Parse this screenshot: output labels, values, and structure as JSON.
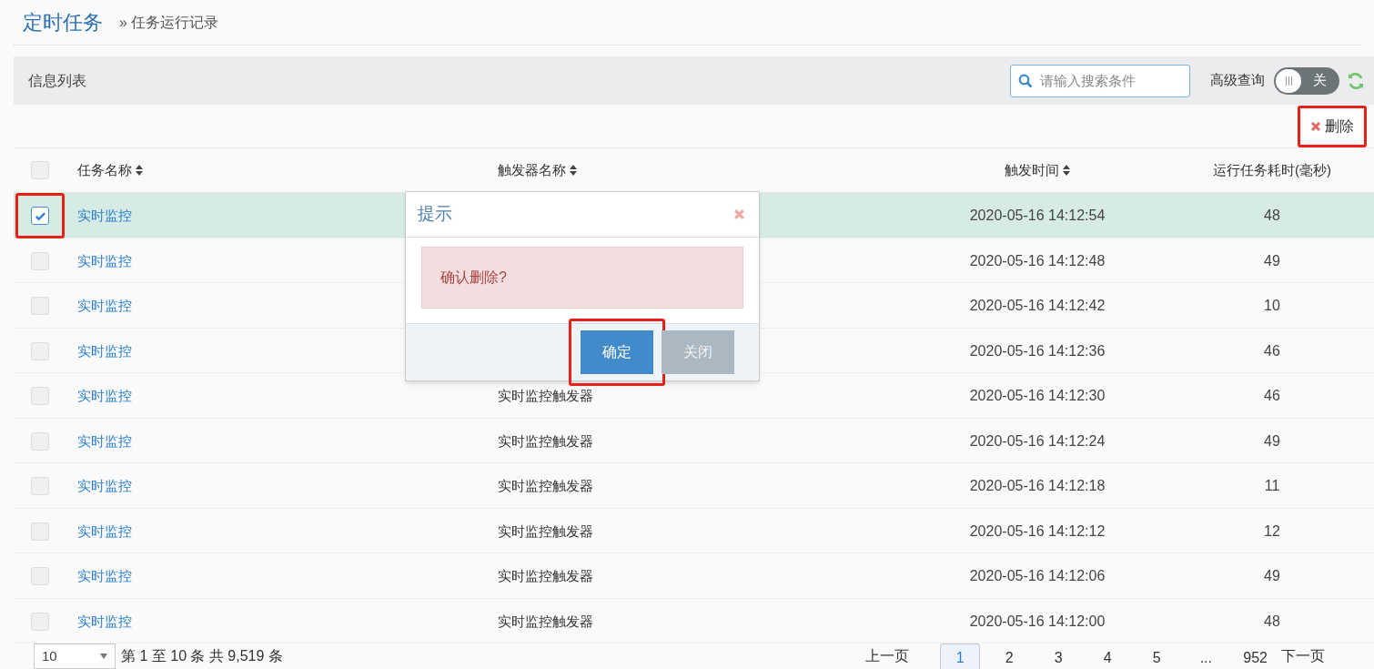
{
  "breadcrumb": {
    "title": "定时任务",
    "separator": "»",
    "current": "任务运行记录"
  },
  "panel": {
    "title": "信息列表",
    "search": {
      "placeholder": "请输入搜索条件"
    },
    "advanced": {
      "label": "高级查询",
      "on": false,
      "toggle_text": "关"
    }
  },
  "toolbar": {
    "delete_label": "删除",
    "highlighted": true
  },
  "table": {
    "header_checked": false,
    "columns": [
      {
        "label": "任务名称",
        "sortable": true
      },
      {
        "label": "触发器名称",
        "sortable": true
      },
      {
        "label": "触发时间",
        "sortable": true
      },
      {
        "label": "运行任务耗时(毫秒)",
        "sortable": false
      }
    ],
    "rows": [
      {
        "selected": true,
        "highlighted": true,
        "task": "实时监控",
        "time": "2020-05-16 14:12:54",
        "duration": "48"
      },
      {
        "selected": false,
        "highlighted": false,
        "task": "实时监控",
        "time": "2020-05-16 14:12:48",
        "duration": "49"
      },
      {
        "selected": false,
        "highlighted": false,
        "task": "实时监控",
        "time": "2020-05-16 14:12:42",
        "duration": "10"
      },
      {
        "selected": false,
        "highlighted": false,
        "task": "实时监控",
        "time": "2020-05-16 14:12:36",
        "duration": "46"
      },
      {
        "selected": false,
        "highlighted": false,
        "task": "实时监控",
        "trigger": "实时监控触发器",
        "time": "2020-05-16 14:12:30",
        "duration": "46"
      },
      {
        "selected": false,
        "highlighted": false,
        "task": "实时监控",
        "trigger": "实时监控触发器",
        "time": "2020-05-16 14:12:24",
        "duration": "49"
      },
      {
        "selected": false,
        "highlighted": false,
        "task": "实时监控",
        "trigger": "实时监控触发器",
        "time": "2020-05-16 14:12:18",
        "duration": "11"
      },
      {
        "selected": false,
        "highlighted": false,
        "task": "实时监控",
        "trigger": "实时监控触发器",
        "time": "2020-05-16 14:12:12",
        "duration": "12"
      },
      {
        "selected": false,
        "highlighted": false,
        "task": "实时监控",
        "trigger": "实时监控触发器",
        "time": "2020-05-16 14:12:06",
        "duration": "49"
      },
      {
        "selected": false,
        "highlighted": false,
        "task": "实时监控",
        "trigger": "实时监控触发器",
        "time": "2020-05-16 14:12:00",
        "duration": "48"
      }
    ]
  },
  "dialog": {
    "title": "提示",
    "message": "确认删除?",
    "buttons": [
      {
        "label": "确定",
        "kind": "primary",
        "highlighted": true
      },
      {
        "label": "关闭",
        "kind": "secondary",
        "highlighted": false
      }
    ]
  },
  "pagination": {
    "page_size": "10",
    "summary": "第 1 至 10 条 共 9,519 条",
    "prev": "上一页",
    "next": "下一页",
    "pages": [
      {
        "label": "1",
        "selected": true
      },
      {
        "label": "2",
        "selected": false
      },
      {
        "label": "3",
        "selected": false
      },
      {
        "label": "4",
        "selected": false
      },
      {
        "label": "5",
        "selected": false
      },
      {
        "label": "...",
        "selected": false
      },
      {
        "label": "952",
        "selected": false
      }
    ]
  }
}
